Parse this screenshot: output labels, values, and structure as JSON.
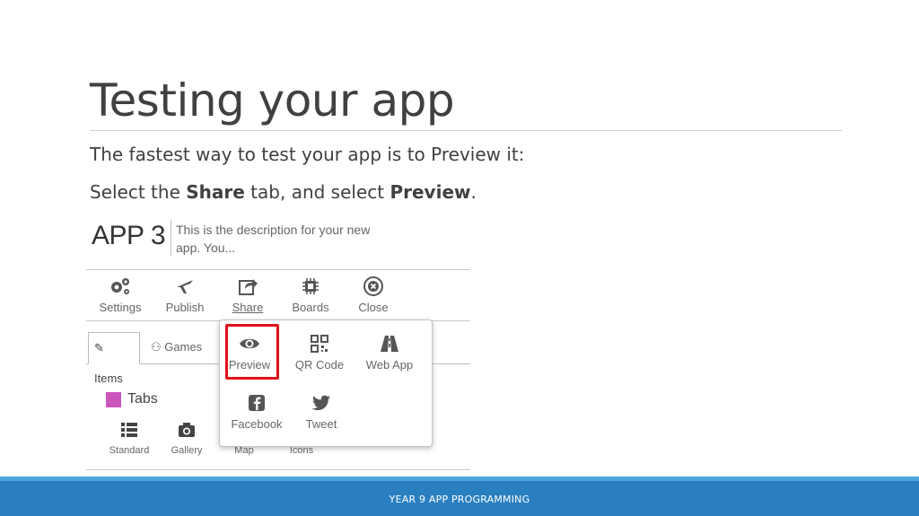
{
  "slide": {
    "title": "Testing your app",
    "line1": "The fastest way to test your app is to Preview it:",
    "line2_pre": "Select the ",
    "line2_b1": "Share",
    "line2_mid": " tab, and select ",
    "line2_b2": "Preview",
    "line2_post": ".",
    "footer": "YEAR 9 APP PROGRAMMING"
  },
  "app": {
    "name": "APP 3",
    "description": "This is the description for your new app. You..."
  },
  "toolbar": {
    "settings": "Settings",
    "publish": "Publish",
    "share": "Share",
    "boards": "Boards",
    "close": "Close"
  },
  "tabs": {
    "items": "Items",
    "games": "Games"
  },
  "section": {
    "label": "Tabs"
  },
  "bottom": {
    "standard": "Standard",
    "gallery": "Gallery",
    "map": "Map",
    "icons": "Icons"
  },
  "share_menu": {
    "preview": "Preview",
    "qr": "QR Code",
    "webapp": "Web App",
    "facebook": "Facebook",
    "tweet": "Tweet"
  },
  "colors": {
    "highlight": "#e0101a",
    "footer": "#2a7fc1",
    "swatch": "#cc55bb"
  }
}
